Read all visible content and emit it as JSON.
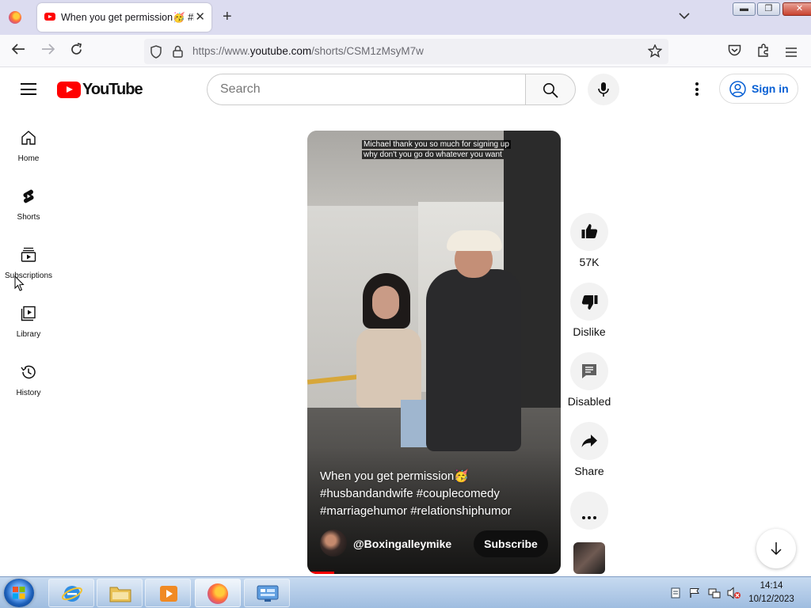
{
  "browser": {
    "tab_title": "When you get permission🥳 #husbandandwife #couplecomedy",
    "url_prefix": "https://www.",
    "url_domain": "youtube.com",
    "url_path": "/shorts/CSM1zMsyM7w"
  },
  "youtube": {
    "logo_text": "YouTube",
    "search_placeholder": "Search",
    "sign_in_label": "Sign in",
    "sidebar": [
      {
        "label": "Home",
        "icon": "home-icon"
      },
      {
        "label": "Shorts",
        "icon": "shorts-icon"
      },
      {
        "label": "Subscriptions",
        "icon": "subscriptions-icon"
      },
      {
        "label": "Library",
        "icon": "library-icon"
      },
      {
        "label": "History",
        "icon": "history-icon"
      }
    ]
  },
  "short": {
    "caption_line1": "Michael thank you so much for signing up",
    "caption_line2": "why don't you go do whatever you want",
    "title": "When you get permission🥳 #husbandandwife #couplecomedy #marriagehumor #relationshiphumor",
    "channel": "@Boxingalleymike",
    "subscribe_label": "Subscribe",
    "likes": "57K",
    "dislike_label": "Dislike",
    "comments_label": "Disabled",
    "share_label": "Share"
  },
  "taskbar": {
    "time": "14:14",
    "date": "10/12/2023"
  }
}
